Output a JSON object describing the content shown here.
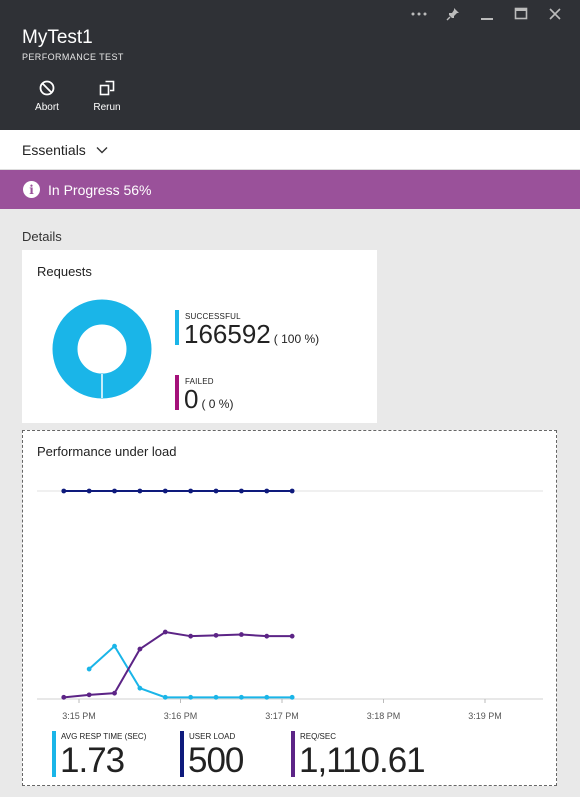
{
  "window": {
    "title": "MyTest1",
    "subtitle": "PERFORMANCE TEST",
    "controls": [
      "more-icon",
      "pin-icon",
      "minimize-icon",
      "maximize-icon",
      "close-icon"
    ]
  },
  "toolbar": {
    "abort_label": "Abort",
    "rerun_label": "Rerun"
  },
  "essentials": {
    "label": "Essentials"
  },
  "status": {
    "text": "In Progress 56%",
    "progress_percent": 56,
    "color": "#9a519a"
  },
  "details": {
    "label": "Details"
  },
  "requests": {
    "title": "Requests",
    "successful": {
      "label": "SUCCESSFUL",
      "value": "166592",
      "percent": "( 100 %)",
      "color": "#1ab5e8"
    },
    "failed": {
      "label": "FAILED",
      "value": "0",
      "percent": "( 0 %)",
      "color": "#a4117a"
    }
  },
  "performance": {
    "title": "Performance under load",
    "stats": [
      {
        "label": "AVG RESP TIME (SEC)",
        "value": "1.73",
        "color": "#1ab5e8"
      },
      {
        "label": "USER LOAD",
        "value": "500",
        "color": "#0e1a7c"
      },
      {
        "label": "REQ/SEC",
        "value": "1,110.61",
        "color": "#5c2486"
      }
    ]
  },
  "chart_data": {
    "type": "line",
    "title": "Performance under load",
    "x_tick_labels": [
      "3:15 PM",
      "3:16 PM",
      "3:17 PM",
      "3:18 PM",
      "3:19 PM"
    ],
    "x_minutes": [
      0,
      1,
      2,
      3,
      4
    ],
    "grid": "single top gridline",
    "series": [
      {
        "name": "USER LOAD",
        "color": "#0e1a7c",
        "x": [
          -0.15,
          0.1,
          0.35,
          0.6,
          0.85,
          1.1,
          1.35,
          1.6,
          1.85,
          2.1
        ],
        "y": [
          0.5,
          0.5,
          0.5,
          0.5,
          0.5,
          0.5,
          0.5,
          0.5,
          0.5,
          0.5
        ]
      },
      {
        "name": "AVG RESP TIME (SEC)",
        "color": "#1ab5e8",
        "x": [
          0.1,
          0.35,
          0.6,
          0.85,
          1.1,
          1.35,
          1.6,
          1.85,
          2.1
        ],
        "y": [
          0.072,
          0.127,
          0.026,
          0.004,
          0.004,
          0.004,
          0.004,
          0.004,
          0.004
        ]
      },
      {
        "name": "REQ/SEC",
        "color": "#5c2486",
        "x": [
          -0.15,
          0.1,
          0.35,
          0.6,
          0.85,
          1.1,
          1.35,
          1.6,
          1.85,
          2.1
        ],
        "y": [
          0.004,
          0.01,
          0.014,
          0.12,
          0.161,
          0.151,
          0.153,
          0.155,
          0.151,
          0.151
        ]
      }
    ]
  }
}
